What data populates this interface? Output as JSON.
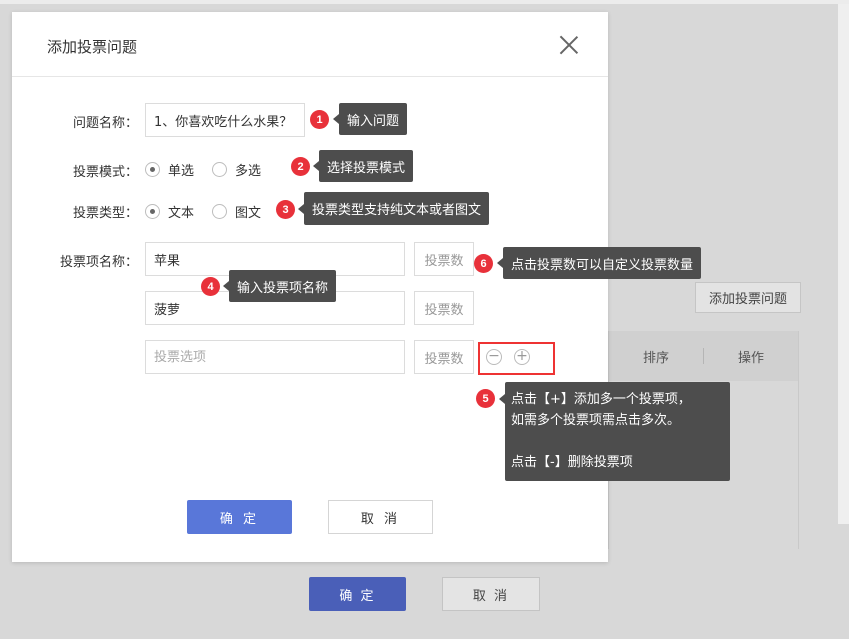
{
  "dialog": {
    "title": "添加投票问题",
    "question_label": "问题名称：",
    "question_value": "1、你喜欢吃什么水果？",
    "mode_label": "投票模式：",
    "mode_options": [
      {
        "label": "单选",
        "checked": true
      },
      {
        "label": "多选",
        "checked": false
      }
    ],
    "type_label": "投票类型：",
    "type_options": [
      {
        "label": "文本",
        "checked": true
      },
      {
        "label": "图文",
        "checked": false
      }
    ],
    "items_label": "投票项名称：",
    "items": [
      {
        "value": "苹果",
        "placeholder": "",
        "count_label": "投票数"
      },
      {
        "value": "菠萝",
        "placeholder": "",
        "count_label": "投票数"
      },
      {
        "value": "",
        "placeholder": "投票选项",
        "count_label": "投票数"
      }
    ],
    "remove_symbol": "−",
    "add_symbol": "+",
    "confirm_label": "确 定",
    "cancel_label": "取 消"
  },
  "annotations": [
    {
      "number": "1",
      "text": "输入问题"
    },
    {
      "number": "2",
      "text": "选择投票模式"
    },
    {
      "number": "3",
      "text": "投票类型支持纯文本或者图文"
    },
    {
      "number": "4",
      "text": "输入投票项名称"
    },
    {
      "number": "5",
      "lines": [
        "点击【+】添加多一个投票项，",
        "如需多个投票项需点击多次。",
        "",
        "点击【-】删除投票项"
      ]
    },
    {
      "number": "6",
      "text": "点击投票数可以自定义投票数量"
    }
  ],
  "background": {
    "add_question_button": "添加投票问题",
    "table_headers": [
      "排序",
      "操作"
    ],
    "confirm_label": "确 定",
    "cancel_label": "取 消"
  },
  "colors": {
    "primary": "#5977d9",
    "annotation_dot": "#e8313a",
    "tooltip_bg": "#4d4d4d",
    "highlight_border": "#ee3333"
  }
}
